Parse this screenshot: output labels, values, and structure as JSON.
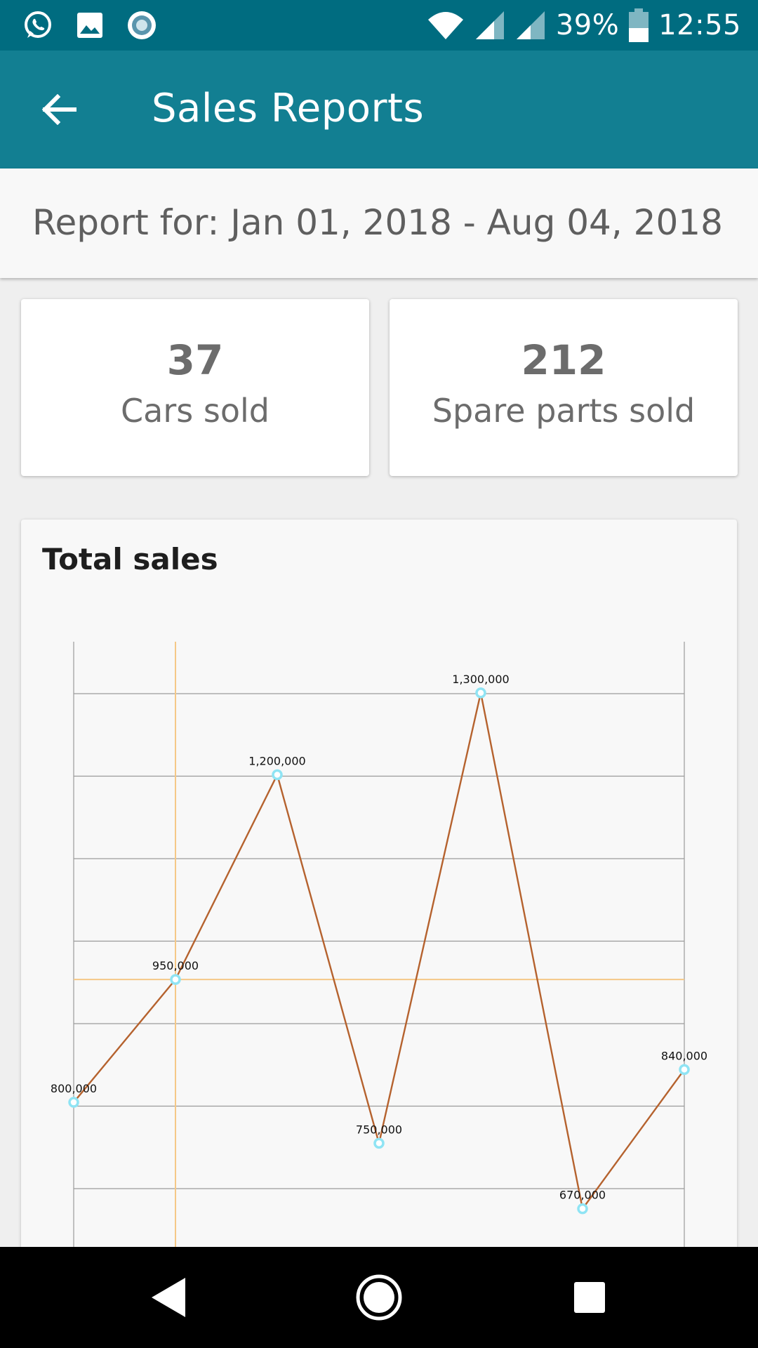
{
  "status_bar": {
    "battery": "39%",
    "time": "12:55",
    "icons": [
      "whatsapp-icon",
      "gallery-icon",
      "record-icon",
      "wifi-icon",
      "signal-icon",
      "signal-icon",
      "battery-icon"
    ]
  },
  "app_bar": {
    "title": "Sales Reports",
    "back_icon": "arrow-back-icon",
    "color": "#127f92"
  },
  "report": {
    "period": "Report for: Jan 01, 2018 - Aug 04, 2018"
  },
  "stats": {
    "cars": {
      "value": "37",
      "label": "Cars sold"
    },
    "parts": {
      "value": "212",
      "label": "Spare parts sold"
    }
  },
  "chart": {
    "title": "Total sales"
  },
  "chart_data": {
    "type": "line",
    "title": "Total sales",
    "xlabel": "",
    "ylabel": "",
    "x": [
      1,
      2,
      3,
      4,
      5,
      6,
      7
    ],
    "series": [
      {
        "values": [
          800000,
          950000,
          1200000,
          750000,
          1300000,
          670000,
          840000
        ],
        "color": "#b5622e"
      }
    ],
    "data_labels": [
      "800,000",
      "950,000",
      "1,200,000",
      "750,000",
      "1,300,000",
      "670,000",
      "840,000"
    ],
    "ylim": [
      620000,
      1362500
    ],
    "grid": true,
    "legend": "none",
    "highlight_index": 1,
    "marker_color": "#8fe4f4",
    "highlight_color": "#f5c887"
  },
  "nav_bar": {
    "back_icon": "nav-back-icon",
    "home_icon": "nav-home-icon",
    "recent_icon": "nav-recent-icon"
  }
}
